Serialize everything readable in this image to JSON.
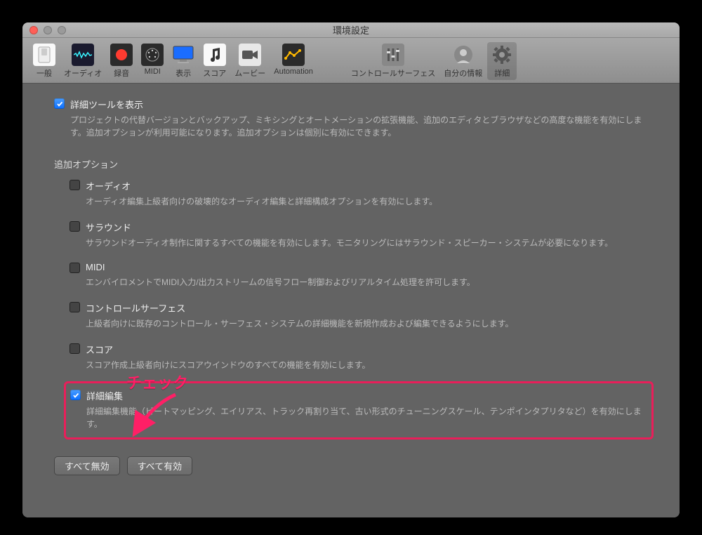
{
  "window": {
    "title": "環境設定"
  },
  "toolbar": {
    "items": [
      {
        "label": "一般"
      },
      {
        "label": "オーディオ"
      },
      {
        "label": "録音"
      },
      {
        "label": "MIDI"
      },
      {
        "label": "表示"
      },
      {
        "label": "スコア"
      },
      {
        "label": "ムービー"
      },
      {
        "label": "Automation"
      },
      {
        "label": "コントロールサーフェス"
      },
      {
        "label": "自分の情報"
      },
      {
        "label": "詳細"
      }
    ]
  },
  "main": {
    "show_advanced": {
      "label": "詳細ツールを表示",
      "desc": "プロジェクトの代替バージョンとバックアップ、ミキシングとオートメーションの拡張機能、追加のエディタとブラウザなどの高度な機能を有効にします。追加オプションが利用可能になります。追加オプションは個別に有効にできます。"
    },
    "section_title": "追加オプション",
    "options": {
      "audio": {
        "label": "オーディオ",
        "desc": "オーディオ編集上級者向けの破壊的なオーディオ編集と詳細構成オプションを有効にします。"
      },
      "surround": {
        "label": "サラウンド",
        "desc": "サラウンドオーディオ制作に関するすべての機能を有効にします。モニタリングにはサラウンド・スピーカー・システムが必要になります。"
      },
      "midi": {
        "label": "MIDI",
        "desc": "エンバイロメントでMIDI入力/出力ストリームの信号フロー制御およびリアルタイム処理を許可します。"
      },
      "control": {
        "label": "コントロールサーフェス",
        "desc": "上級者向けに既存のコントロール・サーフェス・システムの詳細機能を新規作成および編集できるようにします。"
      },
      "score": {
        "label": "スコア",
        "desc": "スコア作成上級者向けにスコアウインドウのすべての機能を有効にします。"
      },
      "edit": {
        "label": "詳細編集",
        "desc": "詳細編集機能（ビートマッピング、エイリアス、トラック再割り当て、古い形式のチューニングスケール、テンポインタプリタなど）を有効にします。"
      }
    },
    "buttons": {
      "disable_all": "すべて無効",
      "enable_all": "すべて有効"
    }
  },
  "annotation": {
    "text": "チェック"
  }
}
